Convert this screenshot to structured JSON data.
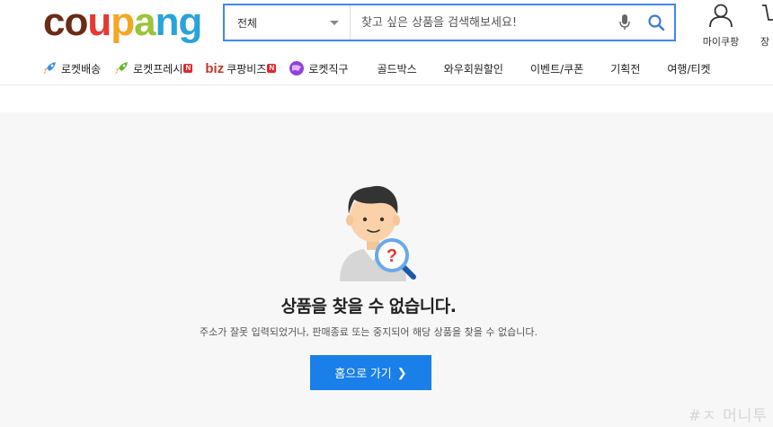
{
  "logo": {
    "letters": [
      "c",
      "o",
      "u",
      "p",
      "a",
      "n",
      "g"
    ],
    "colors": [
      "#6b2b16",
      "#6b2b16",
      "#e53935",
      "#f5a623",
      "#9bc43a",
      "#2aa3d8",
      "#2aa3d8"
    ]
  },
  "search": {
    "category": "전체",
    "placeholder": "찾고 싶은 상품을 검색해보세요!",
    "mic_icon": "mic-icon",
    "search_icon": "search-icon"
  },
  "header_actions": {
    "mypage_label": "마이쿠팡",
    "cart_label": "장"
  },
  "catnav": {
    "rocket_delivery": "로켓배송",
    "rocket_fresh": "로켓프레시",
    "biz_logo": "biz",
    "biz_label": "쿠팡비즈",
    "rocket_direct": "로켓직구",
    "gold_box": "골드박스",
    "wow_discount": "와우회원할인",
    "events": "이벤트/쿠폰",
    "special": "기획전",
    "travel": "여행/티켓",
    "new_badge": "N"
  },
  "content": {
    "title": "상품을 찾을 수 없습니다.",
    "subtitle": "주소가 잘못 입력되었거나, 판매종료 또는 중지되어 해당 상품을 찾을 수 없습니다.",
    "home_button": "홈으로 가기",
    "home_chevron": "❯"
  },
  "watermark": "#ㅈ 머니투"
}
